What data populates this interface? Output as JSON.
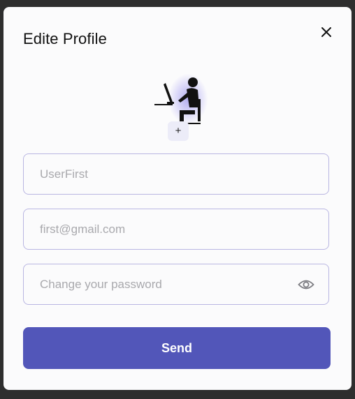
{
  "modal": {
    "title": "Edite Profile",
    "close_icon": "close-icon",
    "avatar_icon": "person-at-computer-icon",
    "add_photo_label": "+"
  },
  "form": {
    "username": {
      "value": "",
      "placeholder": "UserFirst"
    },
    "email": {
      "value": "",
      "placeholder": "first@gmail.com"
    },
    "password": {
      "value": "",
      "placeholder": "Change your password",
      "toggle_icon": "eye-icon"
    },
    "submit_label": "Send"
  },
  "colors": {
    "accent": "#5256b9",
    "field_border": "#b9b6e2",
    "backdrop": "#2e2e2e",
    "modal_bg": "#fbfbfc"
  }
}
